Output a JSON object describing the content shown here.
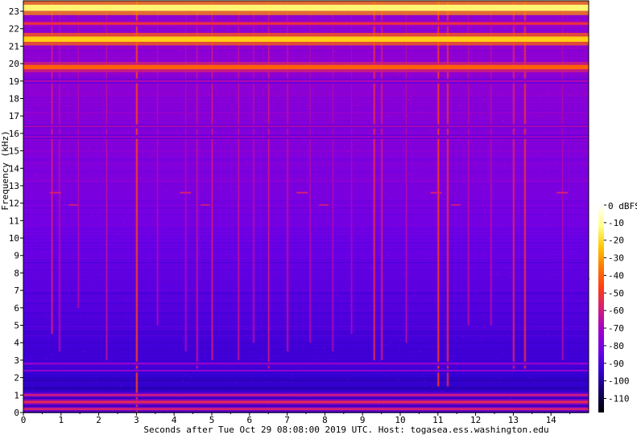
{
  "chart_data": {
    "type": "heatmap",
    "title": "",
    "xlabel": "Seconds after Tue Oct 29 08:08:00 2019 UTC. Host: togasea.ess.washington.edu",
    "ylabel": "Frequency (kHz)",
    "xlim": [
      0,
      15
    ],
    "ylim": [
      0,
      23.6
    ],
    "x_ticks": [
      "0",
      "1",
      "2",
      "3",
      "4",
      "5",
      "6",
      "7",
      "8",
      "9",
      "10",
      "11",
      "12",
      "13",
      "14"
    ],
    "y_ticks": [
      "0",
      "1",
      "2",
      "3",
      "4",
      "5",
      "6",
      "7",
      "8",
      "9",
      "10",
      "11",
      "12",
      "13",
      "14",
      "15",
      "16",
      "17",
      "18",
      "19",
      "20",
      "21",
      "22",
      "23"
    ],
    "colorbar": {
      "unit_label": "0 dBFS",
      "range_dbfs": [
        -118,
        0
      ],
      "tick_labels": [
        "-10",
        "-20",
        "-30",
        "-40",
        "-50",
        "-60",
        "-70",
        "-80",
        "-90",
        "-100",
        "-110"
      ],
      "colors": [
        "#000000",
        "#140064",
        "#3200d2",
        "#6e00e6",
        "#a000c8",
        "#d21e78",
        "#ff3c14",
        "#ff7800",
        "#ffc800",
        "#ffff8c",
        "#ffffff"
      ]
    },
    "background_db": [
      {
        "f": 0,
        "db": -98
      },
      {
        "f": 2,
        "db": -94
      },
      {
        "f": 6,
        "db": -88
      },
      {
        "f": 12,
        "db": -80
      },
      {
        "f": 18,
        "db": -76
      },
      {
        "f": 23.6,
        "db": -75
      }
    ],
    "tonal_bands": [
      {
        "freq_khz": 23.2,
        "level_dbfs": -14,
        "width_khz": 0.35
      },
      {
        "freq_khz": 22.3,
        "level_dbfs": -52,
        "width_khz": 0.15
      },
      {
        "freq_khz": 21.4,
        "level_dbfs": -22,
        "width_khz": 0.3
      },
      {
        "freq_khz": 19.8,
        "level_dbfs": -40,
        "width_khz": 0.25
      },
      {
        "freq_khz": 19.0,
        "level_dbfs": -68,
        "width_khz": 0.12
      },
      {
        "freq_khz": 16.4,
        "level_dbfs": -68,
        "width_khz": 0.1
      },
      {
        "freq_khz": 15.8,
        "level_dbfs": -70,
        "width_khz": 0.1
      },
      {
        "freq_khz": 2.8,
        "level_dbfs": -72,
        "width_khz": 0.1
      },
      {
        "freq_khz": 2.4,
        "level_dbfs": -74,
        "width_khz": 0.1
      },
      {
        "freq_khz": 1.0,
        "level_dbfs": -60,
        "width_khz": 0.12
      },
      {
        "freq_khz": 0.6,
        "level_dbfs": -55,
        "width_khz": 0.15
      },
      {
        "freq_khz": 0.2,
        "level_dbfs": -58,
        "width_khz": 0.12
      }
    ],
    "transients": [
      {
        "t": 0.75,
        "f_low": 4.5,
        "level_dbfs": -58
      },
      {
        "t": 0.95,
        "f_low": 3.5,
        "level_dbfs": -64
      },
      {
        "t": 1.45,
        "f_low": 6.0,
        "level_dbfs": -66
      },
      {
        "t": 2.2,
        "f_low": 3.0,
        "level_dbfs": -64
      },
      {
        "t": 3.0,
        "f_low": 0.0,
        "level_dbfs": -45
      },
      {
        "t": 3.55,
        "f_low": 5.0,
        "level_dbfs": -66
      },
      {
        "t": 4.3,
        "f_low": 3.5,
        "level_dbfs": -66
      },
      {
        "t": 4.6,
        "f_low": 2.5,
        "level_dbfs": -62
      },
      {
        "t": 5.0,
        "f_low": 3.0,
        "level_dbfs": -60
      },
      {
        "t": 5.7,
        "f_low": 3.0,
        "level_dbfs": -62
      },
      {
        "t": 6.1,
        "f_low": 4.0,
        "level_dbfs": -64
      },
      {
        "t": 6.5,
        "f_low": 2.5,
        "level_dbfs": -60
      },
      {
        "t": 7.0,
        "f_low": 3.5,
        "level_dbfs": -62
      },
      {
        "t": 7.6,
        "f_low": 4.0,
        "level_dbfs": -66
      },
      {
        "t": 8.2,
        "f_low": 3.5,
        "level_dbfs": -66
      },
      {
        "t": 8.7,
        "f_low": 4.5,
        "level_dbfs": -68
      },
      {
        "t": 9.3,
        "f_low": 3.0,
        "level_dbfs": -52
      },
      {
        "t": 9.5,
        "f_low": 3.0,
        "level_dbfs": -58
      },
      {
        "t": 10.15,
        "f_low": 4.0,
        "level_dbfs": -66
      },
      {
        "t": 11.0,
        "f_low": 1.5,
        "level_dbfs": -48
      },
      {
        "t": 11.25,
        "f_low": 1.5,
        "level_dbfs": -52
      },
      {
        "t": 11.8,
        "f_low": 5.0,
        "level_dbfs": -64
      },
      {
        "t": 12.4,
        "f_low": 5.0,
        "level_dbfs": -64
      },
      {
        "t": 13.0,
        "f_low": 2.5,
        "level_dbfs": -55
      },
      {
        "t": 13.3,
        "f_low": 2.5,
        "level_dbfs": -50
      },
      {
        "t": 14.3,
        "f_low": 3.0,
        "level_dbfs": -66
      }
    ],
    "chirps": [
      {
        "t_start": 0.7,
        "t_end": 1.0,
        "freq_khz": 12.6,
        "level_dbfs": -58
      },
      {
        "t_start": 1.2,
        "t_end": 1.45,
        "freq_khz": 11.9,
        "level_dbfs": -60
      },
      {
        "t_start": 4.15,
        "t_end": 4.45,
        "freq_khz": 12.6,
        "level_dbfs": -58
      },
      {
        "t_start": 4.7,
        "t_end": 4.95,
        "freq_khz": 11.9,
        "level_dbfs": -60
      },
      {
        "t_start": 7.25,
        "t_end": 7.55,
        "freq_khz": 12.6,
        "level_dbfs": -58
      },
      {
        "t_start": 7.85,
        "t_end": 8.1,
        "freq_khz": 11.9,
        "level_dbfs": -60
      },
      {
        "t_start": 10.8,
        "t_end": 11.1,
        "freq_khz": 12.6,
        "level_dbfs": -58
      },
      {
        "t_start": 11.35,
        "t_end": 11.6,
        "freq_khz": 11.9,
        "level_dbfs": -60
      },
      {
        "t_start": 14.15,
        "t_end": 14.45,
        "freq_khz": 12.6,
        "level_dbfs": -58
      }
    ]
  }
}
